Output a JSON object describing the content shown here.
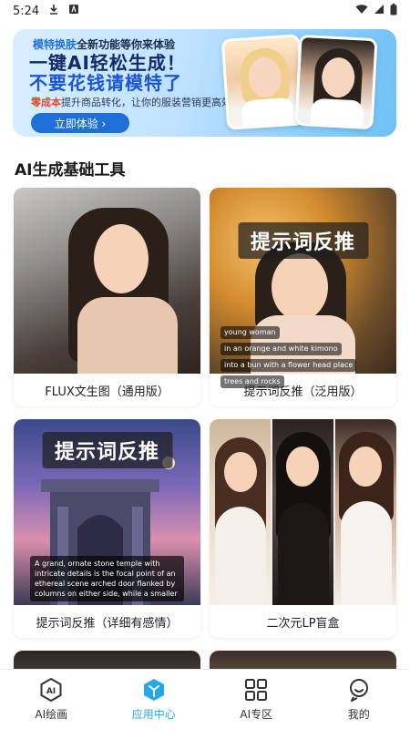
{
  "status_bar": {
    "time": "5:24"
  },
  "banner": {
    "tag_highlight": "模特换肤",
    "tag_rest": "全新功能等你来体验",
    "title_line1": "一键AI轻松生成！",
    "title_line2": "不要花钱请模特了",
    "sub_highlight": "零成本",
    "sub_rest": "提升商品转化，让你的服装营销更高效",
    "button_label": "立即体验 ›"
  },
  "section": {
    "title": "AI生成基础工具"
  },
  "cards": [
    {
      "label": "FLUX文生图（通用版）"
    },
    {
      "label": "提示词反推（泛用版）",
      "overlay_title": "提示词反推",
      "chips": [
        "young woman",
        "in an orange and white kimono",
        "into a bun with a flower head place",
        "trees and rocks"
      ]
    },
    {
      "label": "提示词反推（详细有感情）",
      "overlay_title": "提示词反推",
      "desc": "A grand, ornate stone temple with intricate details is the focal point of an ethereal scene arched door flanked by columns on either side, while a smaller"
    },
    {
      "label": "二次元LP盲盒"
    }
  ],
  "tabbar": {
    "items": [
      {
        "label": "AI绘画",
        "icon": "ai-hexagon-icon",
        "active": false
      },
      {
        "label": "应用中心",
        "icon": "app-center-icon",
        "active": true
      },
      {
        "label": "AI专区",
        "icon": "grid-icon",
        "active": false
      },
      {
        "label": "我的",
        "icon": "profile-icon",
        "active": false
      }
    ],
    "active_color": "#27a8e6"
  }
}
